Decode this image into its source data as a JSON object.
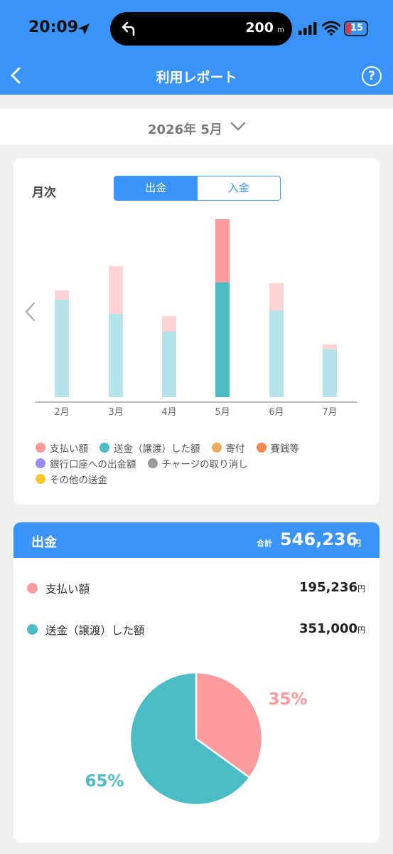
{
  "status_bar": {
    "time": "20:09",
    "nav_distance": "200",
    "nav_unit": "m",
    "battery": "15"
  },
  "header": {
    "title": "利用レポート",
    "help": "?"
  },
  "month_selector": {
    "label": "2026年 5月"
  },
  "chart_section": {
    "label": "月次",
    "tabs": [
      "出金",
      "入金"
    ],
    "active_tab": "出金"
  },
  "chart_data": {
    "type": "bar",
    "stacked": true,
    "categories": [
      "2月",
      "3月",
      "4月",
      "5月",
      "6月",
      "7月"
    ],
    "selected_category": "5月",
    "series": [
      {
        "name": "送金（譲渡）した額",
        "values": [
          137,
          117,
          92,
          161,
          122,
          67
        ],
        "color": "#b4e3e8",
        "selected_color": "#4bbcc5"
      },
      {
        "name": "支払い額",
        "values": [
          13,
          67,
          22,
          89,
          38,
          7
        ],
        "color": "#ffd3d3",
        "selected_color": "#fc9b9d"
      }
    ],
    "ylim": [
      0,
      260
    ]
  },
  "legend": [
    [
      {
        "label": "支払い額",
        "color": "#fc9b9d"
      },
      {
        "label": "送金（譲渡）した額",
        "color": "#4bbcc5"
      },
      {
        "label": "寄付",
        "color": "#e9a95e"
      },
      {
        "label": "賽銭等",
        "color": "#f28a4d"
      }
    ],
    [
      {
        "label": "銀行口座への出金額",
        "color": "#9b8bf0"
      },
      {
        "label": "チャージの取り消し",
        "color": "#9a9a9a"
      }
    ],
    [
      {
        "label": "その他の送金",
        "color": "#f7c631"
      }
    ]
  ],
  "summary": {
    "title": "出金",
    "total_label": "合計",
    "total": "546,236",
    "currency": "円",
    "rows": [
      {
        "label": "支払い額",
        "amount": "195,236",
        "color": "#fc9b9d"
      },
      {
        "label": "送金（譲渡）した額",
        "amount": "351,000",
        "color": "#4bbcc5"
      }
    ]
  },
  "pie": {
    "slices": [
      {
        "name": "支払い額",
        "percent": 35,
        "label": "35%",
        "color": "#fc9b9d"
      },
      {
        "name": "送金（譲渡）した額",
        "percent": 65,
        "label": "65%",
        "color": "#4bbcc5"
      }
    ]
  }
}
